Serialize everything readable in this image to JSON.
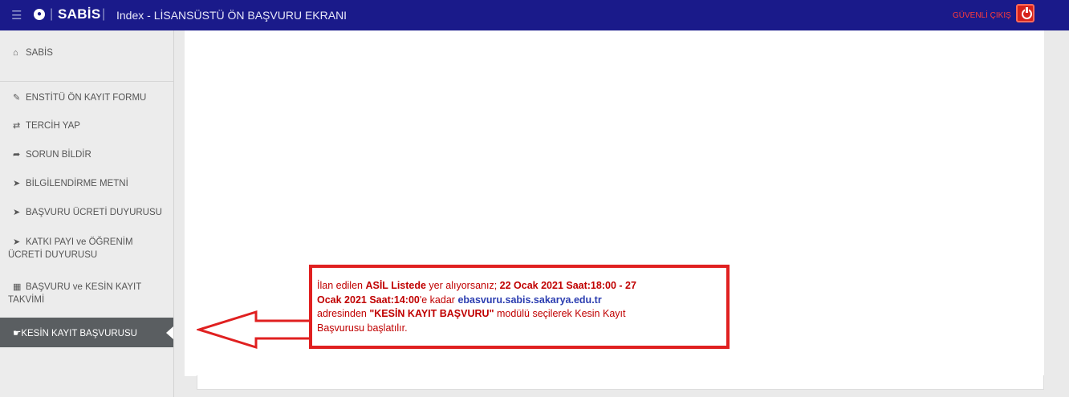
{
  "header": {
    "brand": "SABİS",
    "title": "Index - LİSANSÜSTÜ ÖN BAŞVURU EKRANI",
    "logout_label": "GÜVENLİ ÇIKIŞ"
  },
  "sidebar": {
    "items": [
      {
        "label": "SABİS",
        "icon": "home-icon"
      },
      {
        "label": "ENSTİTÜ ÖN KAYIT FORMU",
        "icon": "pencil-icon"
      },
      {
        "label": "TERCİH YAP",
        "icon": "exchange-icon"
      },
      {
        "label": "SORUN BİLDİR",
        "icon": "share-arrow-icon"
      },
      {
        "label": "BİLGİLENDİRME METNİ",
        "icon": "megaphone-icon"
      },
      {
        "label": "BAŞVURU ÜCRETİ DUYURUSU",
        "icon": "megaphone-icon"
      },
      {
        "label_line1": "KATKI PAYI ve ÖĞRENİM",
        "label_line2": "ÜCRETİ DUYURUSU",
        "icon": "megaphone-icon"
      },
      {
        "label_line1": "BAŞVURU ve KESİN KAYIT",
        "label_line2": "TAKVİMİ",
        "icon": "calendar-icon"
      },
      {
        "label": "KESİN KAYIT BAŞVURUSU",
        "icon": "thumbs-up-icon",
        "active": true
      }
    ]
  },
  "notice": {
    "l1_a": "İlan edilen ",
    "l1_b": "ASİL Listede",
    "l1_c": " yer alıyorsanız; ",
    "l1_d": "22 Ocak 2021 Saat:18:00 - 27",
    "l2_a": "Ocak 2021 Saat:14:00",
    "l2_b": "'e kadar ",
    "l2_c": "ebasvuru.sabis.sakarya.edu.tr",
    "l3_a": "adresinden ",
    "l3_b": "\"KESİN KAYIT BAŞVURU\"",
    "l3_c": " modülü seçilerek Kesin Kayıt",
    "l4": "Başvurusu başlatılır."
  },
  "colors": {
    "header_bg": "#1a1a8a",
    "active_item_bg": "#5a5e61",
    "notice_border": "#e02020",
    "link_blue": "#2b3db0"
  }
}
